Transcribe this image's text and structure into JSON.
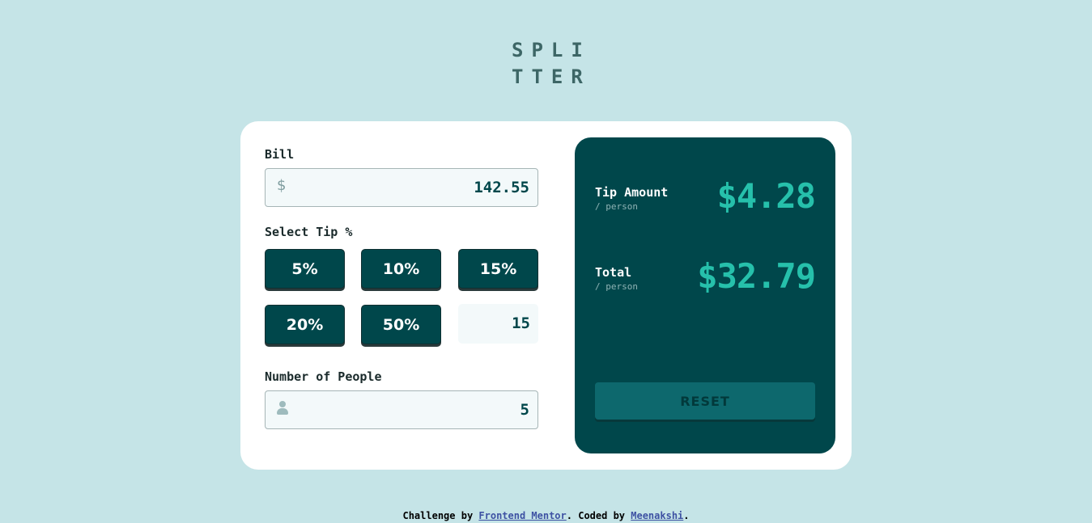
{
  "logo": {
    "line1": "SPLI",
    "line2": "TTER"
  },
  "bill": {
    "label": "Bill",
    "currency_symbol": "$",
    "value": "142.55"
  },
  "tip": {
    "label": "Select Tip %",
    "options": [
      "5%",
      "10%",
      "15%",
      "20%",
      "50%"
    ],
    "custom_value": "15"
  },
  "people": {
    "label": "Number of People",
    "value": "5",
    "icon": "person-icon"
  },
  "results": {
    "tip_amount_label": "Tip Amount",
    "tip_amount_sub": "/ person",
    "tip_amount_value": "$4.28",
    "total_label": "Total",
    "total_sub": "/ person",
    "total_value": "$32.79",
    "reset_label": "RESET"
  },
  "footer": {
    "prefix": "Challenge by ",
    "link1": "Frontend Mentor",
    "middle": ". Coded by ",
    "link2": "Meenakshi",
    "suffix": "."
  },
  "colors": {
    "background": "#c5e4e7",
    "primary": "#00474b",
    "accent": "#26c0ab",
    "input_bg": "#f3f9fa"
  }
}
